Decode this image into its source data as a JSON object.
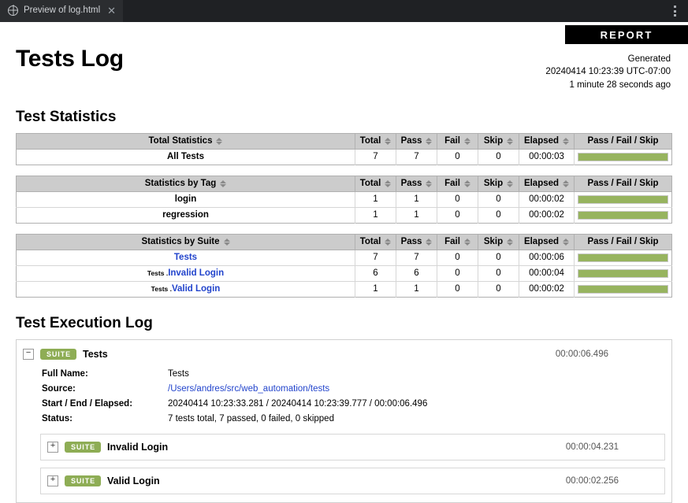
{
  "window": {
    "tab_title": "Preview of log.html",
    "tab_icon": "globe-icon",
    "close_icon": "close-icon",
    "menu_icon": "kebab-menu-icon"
  },
  "report": {
    "banner_label": "REPORT",
    "title": "Tests Log",
    "generated_label": "Generated",
    "generated_timestamp": "20240414 10:23:39 UTC-07:00",
    "generated_relative": "1 minute 28 seconds ago"
  },
  "sections": {
    "statistics_heading": "Test Statistics",
    "execution_heading": "Test Execution Log"
  },
  "colors": {
    "pass": "#97b45f",
    "fail": "#d9534f",
    "skip": "#e8c76a",
    "link": "#2244cc",
    "header_bg": "#cccccc",
    "banner_bg": "#000000"
  },
  "common_columns": {
    "total": "Total",
    "pass": "Pass",
    "fail": "Fail",
    "skip": "Skip",
    "elapsed": "Elapsed",
    "graph": "Pass / Fail / Skip"
  },
  "total_statistics": {
    "title": "Total Statistics",
    "rows": [
      {
        "name": "All Tests",
        "total": "7",
        "pass": "7",
        "fail": "0",
        "skip": "0",
        "elapsed": "00:00:03",
        "pass_pct": 100,
        "fail_pct": 0,
        "skip_pct": 0
      }
    ]
  },
  "tag_statistics": {
    "title": "Statistics by Tag",
    "rows": [
      {
        "name": "login",
        "total": "1",
        "pass": "1",
        "fail": "0",
        "skip": "0",
        "elapsed": "00:00:02",
        "pass_pct": 100,
        "fail_pct": 0,
        "skip_pct": 0
      },
      {
        "name": "regression",
        "total": "1",
        "pass": "1",
        "fail": "0",
        "skip": "0",
        "elapsed": "00:00:02",
        "pass_pct": 100,
        "fail_pct": 0,
        "skip_pct": 0
      }
    ]
  },
  "suite_statistics": {
    "title": "Statistics by Suite",
    "rows": [
      {
        "parent": "",
        "name": "Tests",
        "total": "7",
        "pass": "7",
        "fail": "0",
        "skip": "0",
        "elapsed": "00:00:06",
        "pass_pct": 100,
        "fail_pct": 0,
        "skip_pct": 0
      },
      {
        "parent": "Tests .",
        "name": "Invalid Login",
        "total": "6",
        "pass": "6",
        "fail": "0",
        "skip": "0",
        "elapsed": "00:00:04",
        "pass_pct": 100,
        "fail_pct": 0,
        "skip_pct": 0
      },
      {
        "parent": "Tests .",
        "name": "Valid Login",
        "total": "1",
        "pass": "1",
        "fail": "0",
        "skip": "0",
        "elapsed": "00:00:02",
        "pass_pct": 100,
        "fail_pct": 0,
        "skip_pct": 0
      }
    ]
  },
  "execution_log": {
    "root": {
      "toggle": "−",
      "badge": "SUITE",
      "name": "Tests",
      "elapsed": "00:00:06.496",
      "details": [
        {
          "label": "Full Name:",
          "value": "Tests",
          "is_link": false
        },
        {
          "label": "Source:",
          "value": "/Users/andres/src/web_automation/tests",
          "is_link": true
        },
        {
          "label": "Start / End / Elapsed:",
          "value": "20240414 10:23:33.281 / 20240414 10:23:39.777 / 00:00:06.496",
          "is_link": false
        },
        {
          "label": "Status:",
          "value": "7 tests total, 7 passed, 0 failed, 0 skipped",
          "is_link": false
        }
      ]
    },
    "children": [
      {
        "toggle": "+",
        "badge": "SUITE",
        "name": "Invalid Login",
        "elapsed": "00:00:04.231"
      },
      {
        "toggle": "+",
        "badge": "SUITE",
        "name": "Valid Login",
        "elapsed": "00:00:02.256"
      }
    ]
  }
}
